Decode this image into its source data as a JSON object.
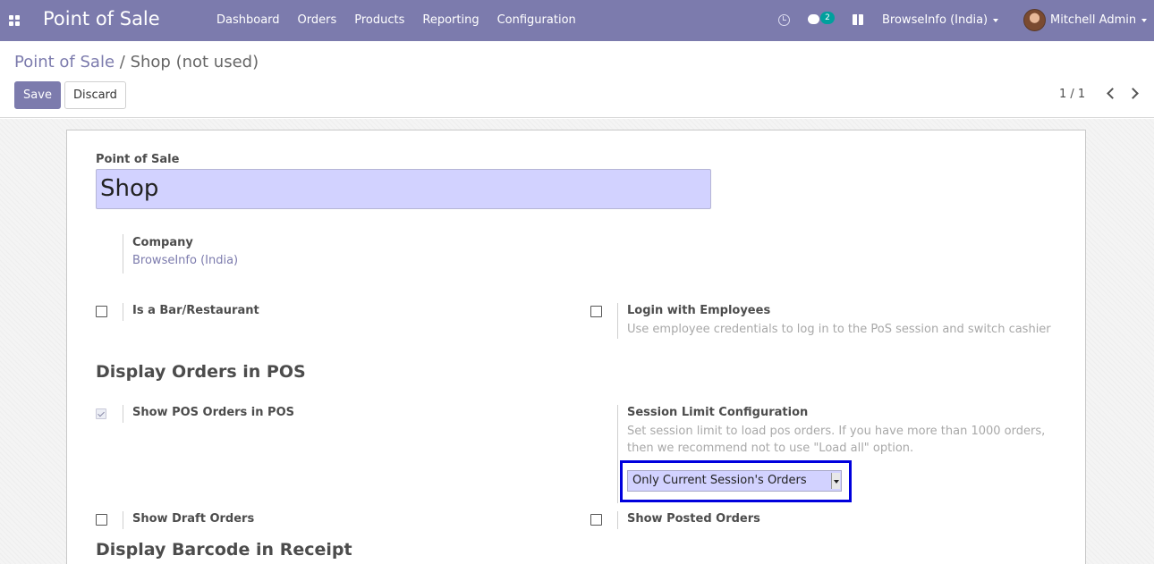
{
  "navbar": {
    "app_title": "Point of Sale",
    "menu": [
      "Dashboard",
      "Orders",
      "Products",
      "Reporting",
      "Configuration"
    ],
    "chat_count": "2",
    "company": "BrowseInfo (India)",
    "user": "Mitchell Admin",
    "icons": [
      "apps-icon",
      "clock-icon",
      "chat-icon",
      "gift-icon",
      "avatar"
    ],
    "accent_color": "#7c7bad"
  },
  "control_panel": {
    "breadcrumb_root": "Point of Sale",
    "breadcrumb_separator": "/",
    "breadcrumb_current": "Shop (not used)",
    "save_label": "Save",
    "discard_label": "Discard",
    "pager": "1 / 1"
  },
  "form": {
    "name_label": "Point of Sale",
    "name_value": "Shop",
    "company_label": "Company",
    "company_value": "BrowseInfo (India)",
    "bar_restaurant": {
      "label": "Is a Bar/Restaurant",
      "checked": false
    },
    "login_employees": {
      "label": "Login with Employees",
      "help": "Use employee credentials to log in to the PoS session and switch cashier",
      "checked": false
    },
    "section_display_orders": "Display Orders in POS",
    "show_pos_orders": {
      "label": "Show POS Orders in POS",
      "checked": true
    },
    "session_limit": {
      "label": "Session Limit Configuration",
      "help_line1": "Set session limit to load pos orders. If you have more than 1000 orders,",
      "help_line2": "then we recommend not to use \"Load all\" option.",
      "selected": "Only Current Session's Orders"
    },
    "show_draft_orders": {
      "label": "Show Draft Orders",
      "checked": false
    },
    "show_posted_orders": {
      "label": "Show Posted Orders",
      "checked": false
    },
    "section_display_barcode": "Display Barcode in Receipt"
  }
}
